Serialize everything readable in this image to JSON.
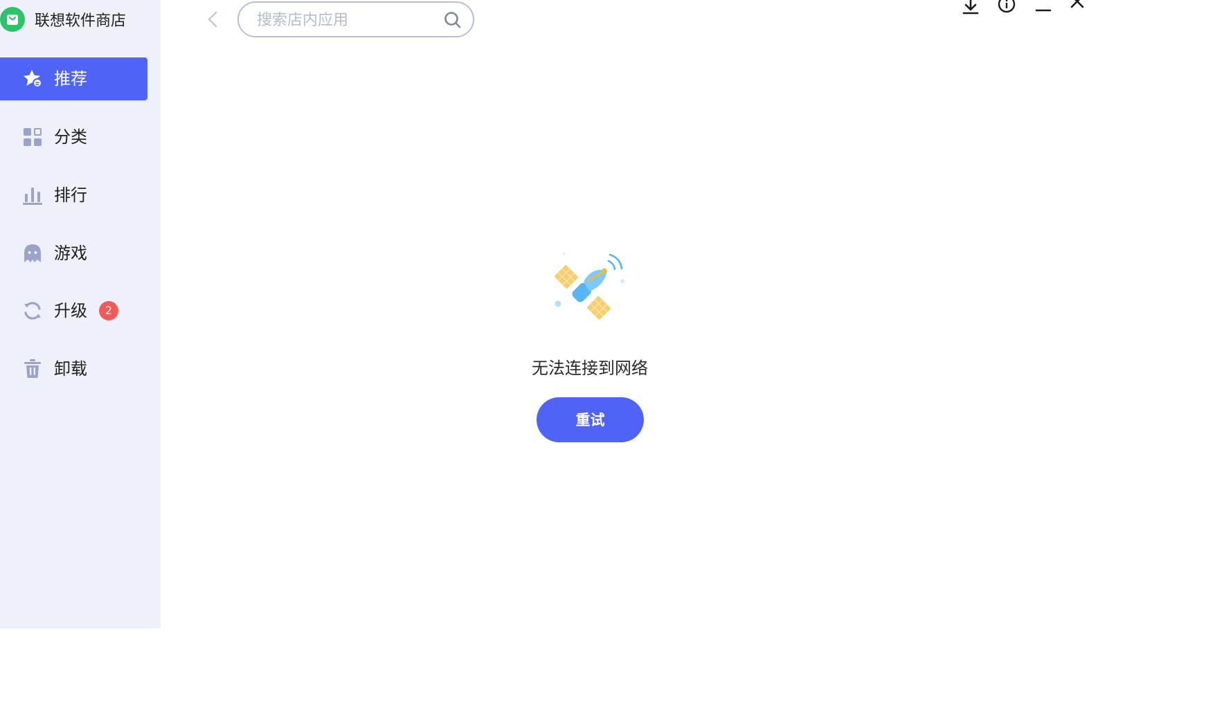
{
  "app": {
    "title": "联想软件商店",
    "logo_icon": "shopping-bag-icon",
    "brand_color": "#2cc36b"
  },
  "sidebar": {
    "items": [
      {
        "label": "推荐",
        "icon": "star-icon",
        "active": true
      },
      {
        "label": "分类",
        "icon": "grid-icon",
        "active": false
      },
      {
        "label": "排行",
        "icon": "bar-chart-icon",
        "active": false
      },
      {
        "label": "游戏",
        "icon": "ghost-icon",
        "active": false
      },
      {
        "label": "升级",
        "icon": "refresh-icon",
        "active": false,
        "badge": "2"
      },
      {
        "label": "卸载",
        "icon": "trash-icon",
        "active": false
      }
    ],
    "accent_color": "#4f63f6",
    "badge_color": "#f05a5a"
  },
  "toolbar": {
    "back_icon": "chevron-left-icon",
    "search": {
      "placeholder": "搜索店内应用",
      "value": ""
    },
    "window_controls": [
      "download-icon",
      "info-icon",
      "minimize-icon",
      "close-icon"
    ]
  },
  "main": {
    "illustration_icon": "satellite-icon",
    "error_message": "无法连接到网络",
    "retry_label": "重试"
  }
}
